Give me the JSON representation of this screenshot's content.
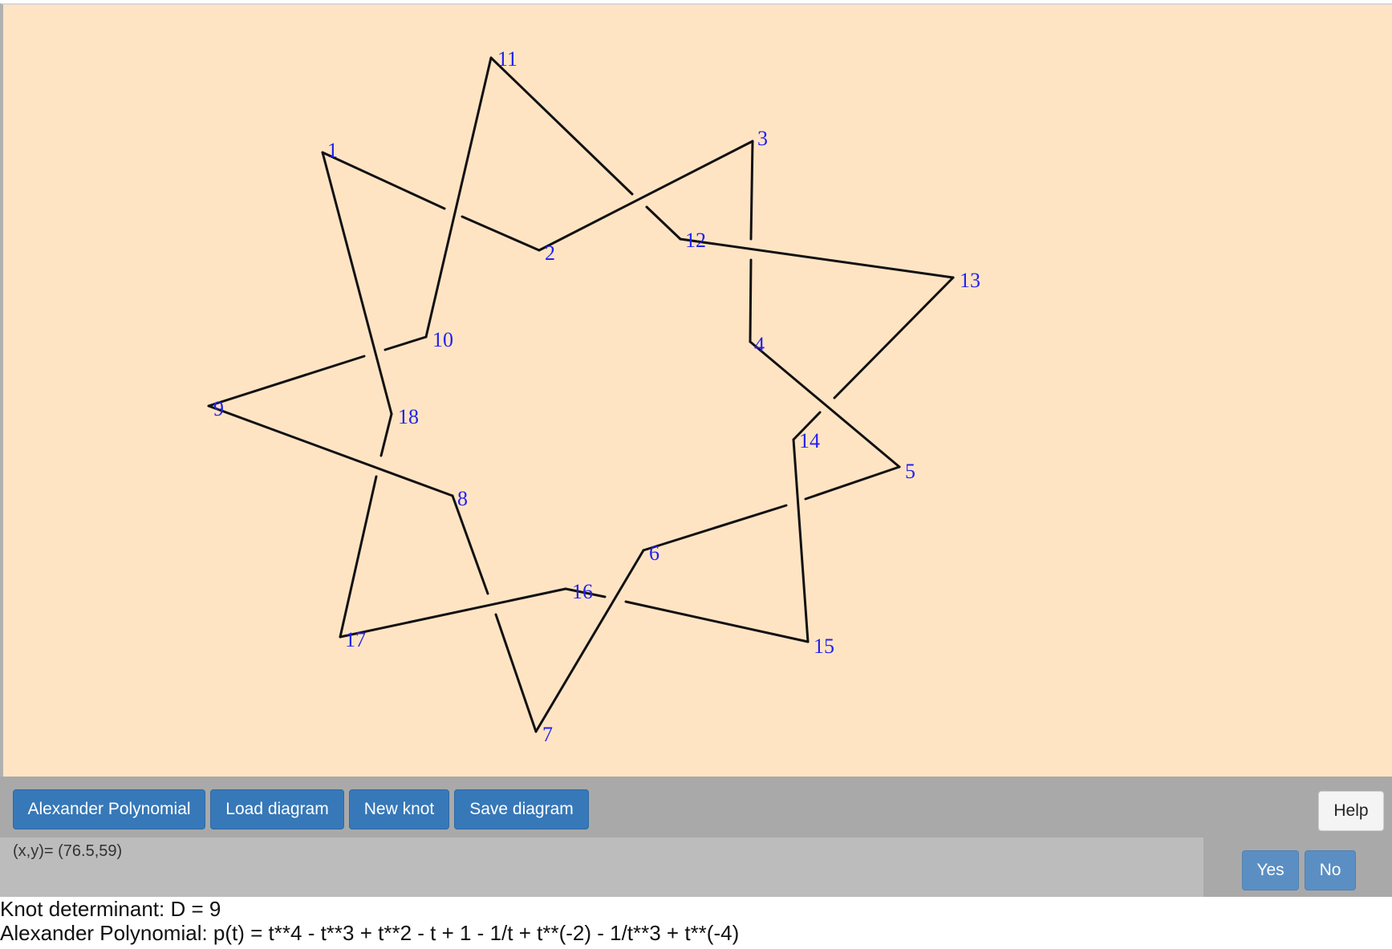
{
  "diagram": {
    "vertices": [
      {
        "id": "1",
        "label": "1"
      },
      {
        "id": "2",
        "label": "2"
      },
      {
        "id": "3",
        "label": "3"
      },
      {
        "id": "4",
        "label": "4"
      },
      {
        "id": "5",
        "label": "5"
      },
      {
        "id": "6",
        "label": "6"
      },
      {
        "id": "7",
        "label": "7"
      },
      {
        "id": "8",
        "label": "8"
      },
      {
        "id": "9",
        "label": "9"
      },
      {
        "id": "10",
        "label": "10"
      },
      {
        "id": "11",
        "label": "11"
      },
      {
        "id": "12",
        "label": "12"
      },
      {
        "id": "13",
        "label": "13"
      },
      {
        "id": "14",
        "label": "14"
      },
      {
        "id": "15",
        "label": "15"
      },
      {
        "id": "16",
        "label": "16"
      },
      {
        "id": "17",
        "label": "17"
      },
      {
        "id": "18",
        "label": "18"
      }
    ],
    "line_color": "#111111",
    "label_color": "#2222ee",
    "background_color": "#ffe4c4"
  },
  "toolbar": {
    "alexander_label": "Alexander Polynomial",
    "load_label": "Load diagram",
    "new_label": "New knot",
    "save_label": "Save diagram",
    "help_label": "Help",
    "button_color": "#3778b8"
  },
  "status": {
    "coords": "(x,y)= (76.5,59)",
    "yes_label": "Yes",
    "no_label": "No"
  },
  "results": {
    "determinant": "Knot determinant: D = 9",
    "polynomial": "Alexander Polynomial: p(t) = t**4 - t**3 + t**2 - t + 1 - 1/t + t**(-2) - 1/t**3 + t**(-4)"
  }
}
